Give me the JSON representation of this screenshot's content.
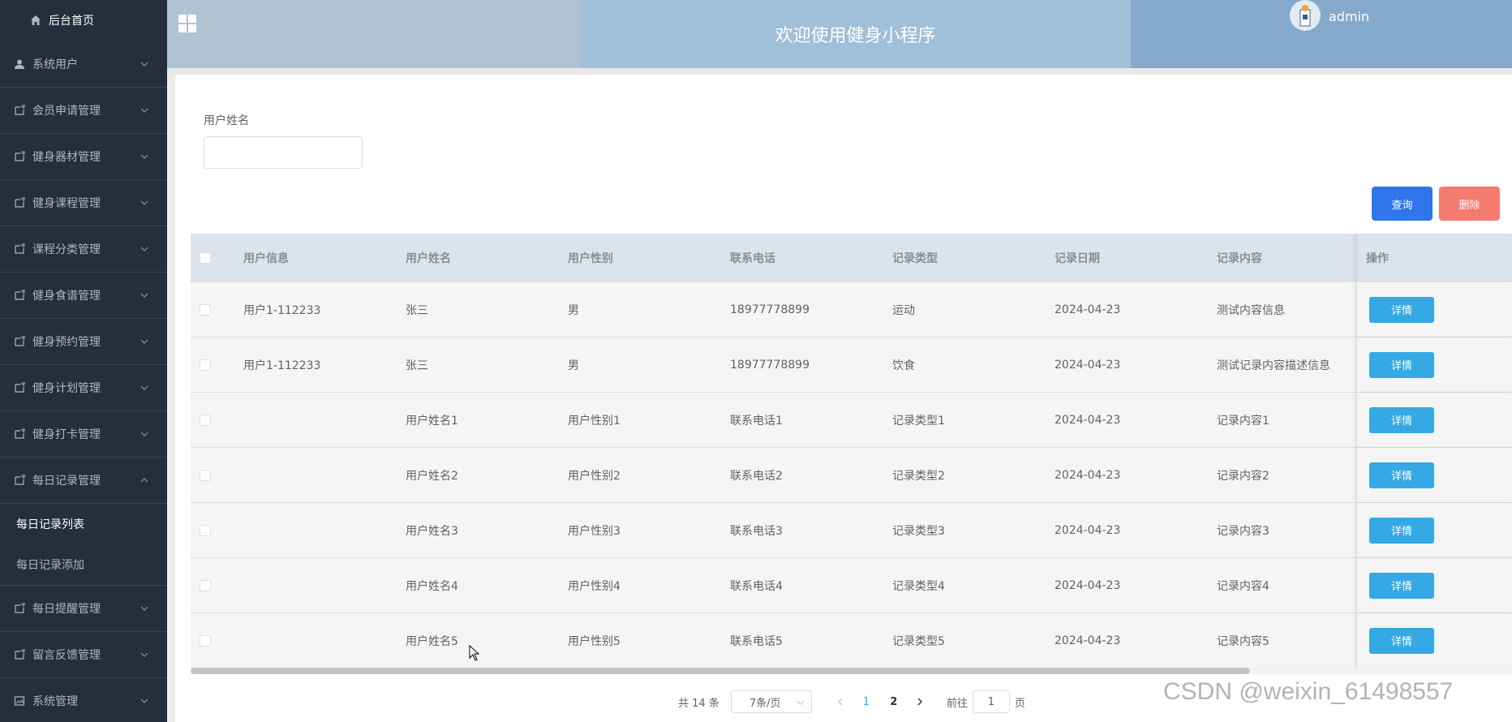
{
  "sidebar": {
    "home_label": "后台首页",
    "items": [
      {
        "label": "系统用户",
        "icon": "user-icon"
      },
      {
        "label": "会员申请管理",
        "icon": "folder-icon"
      },
      {
        "label": "健身器材管理",
        "icon": "folder-icon"
      },
      {
        "label": "健身课程管理",
        "icon": "folder-icon"
      },
      {
        "label": "课程分类管理",
        "icon": "folder-icon"
      },
      {
        "label": "健身食谱管理",
        "icon": "folder-icon"
      },
      {
        "label": "健身预约管理",
        "icon": "folder-icon"
      },
      {
        "label": "健身计划管理",
        "icon": "folder-icon"
      },
      {
        "label": "健身打卡管理",
        "icon": "folder-icon"
      },
      {
        "label": "每日记录管理",
        "icon": "folder-icon",
        "expanded": true
      },
      {
        "label": "每日提醒管理",
        "icon": "folder-icon"
      },
      {
        "label": "留言反馈管理",
        "icon": "folder-icon"
      },
      {
        "label": "系统管理",
        "icon": "image-icon"
      }
    ],
    "submenu": [
      {
        "label": "每日记录列表",
        "active": true
      },
      {
        "label": "每日记录添加",
        "active": false
      }
    ]
  },
  "header": {
    "title": "欢迎使用健身小程序",
    "username": "admin"
  },
  "search": {
    "label": "用户姓名",
    "value": "",
    "query_button": "查询",
    "delete_button": "删除"
  },
  "table": {
    "columns": [
      "用户信息",
      "用户姓名",
      "用户性别",
      "联系电话",
      "记录类型",
      "记录日期",
      "记录内容",
      "操作"
    ],
    "detail_label": "详情",
    "rows": [
      [
        "用户1-112233",
        "张三",
        "男",
        "18977778899",
        "运动",
        "2024-04-23",
        "测试内容信息"
      ],
      [
        "用户1-112233",
        "张三",
        "男",
        "18977778899",
        "饮食",
        "2024-04-23",
        "测试记录内容描述信息"
      ],
      [
        "",
        "用户姓名1",
        "用户性别1",
        "联系电话1",
        "记录类型1",
        "2024-04-23",
        "记录内容1"
      ],
      [
        "",
        "用户姓名2",
        "用户性别2",
        "联系电话2",
        "记录类型2",
        "2024-04-23",
        "记录内容2"
      ],
      [
        "",
        "用户姓名3",
        "用户性别3",
        "联系电话3",
        "记录类型3",
        "2024-04-23",
        "记录内容3"
      ],
      [
        "",
        "用户姓名4",
        "用户性别4",
        "联系电话4",
        "记录类型4",
        "2024-04-23",
        "记录内容4"
      ],
      [
        "",
        "用户姓名5",
        "用户性别5",
        "联系电话5",
        "记录类型5",
        "2024-04-23",
        "记录内容5"
      ]
    ]
  },
  "pagination": {
    "total_text": "共 14 条",
    "page_size": "7条/页",
    "pages": [
      "1",
      "2"
    ],
    "current_page": "1",
    "goto_prefix": "前往",
    "goto_value": "1",
    "goto_suffix": "页"
  },
  "watermark": "CSDN @weixin_61498557",
  "colors": {
    "sidebar_bg": "#252e3d",
    "query_button": "#2e76ea",
    "delete_button": "#f57b6e",
    "detail_button": "#35a9e3",
    "header_left": "#afc3d3",
    "header_mid": "#a0bfd8",
    "header_right": "#84a9ca"
  }
}
